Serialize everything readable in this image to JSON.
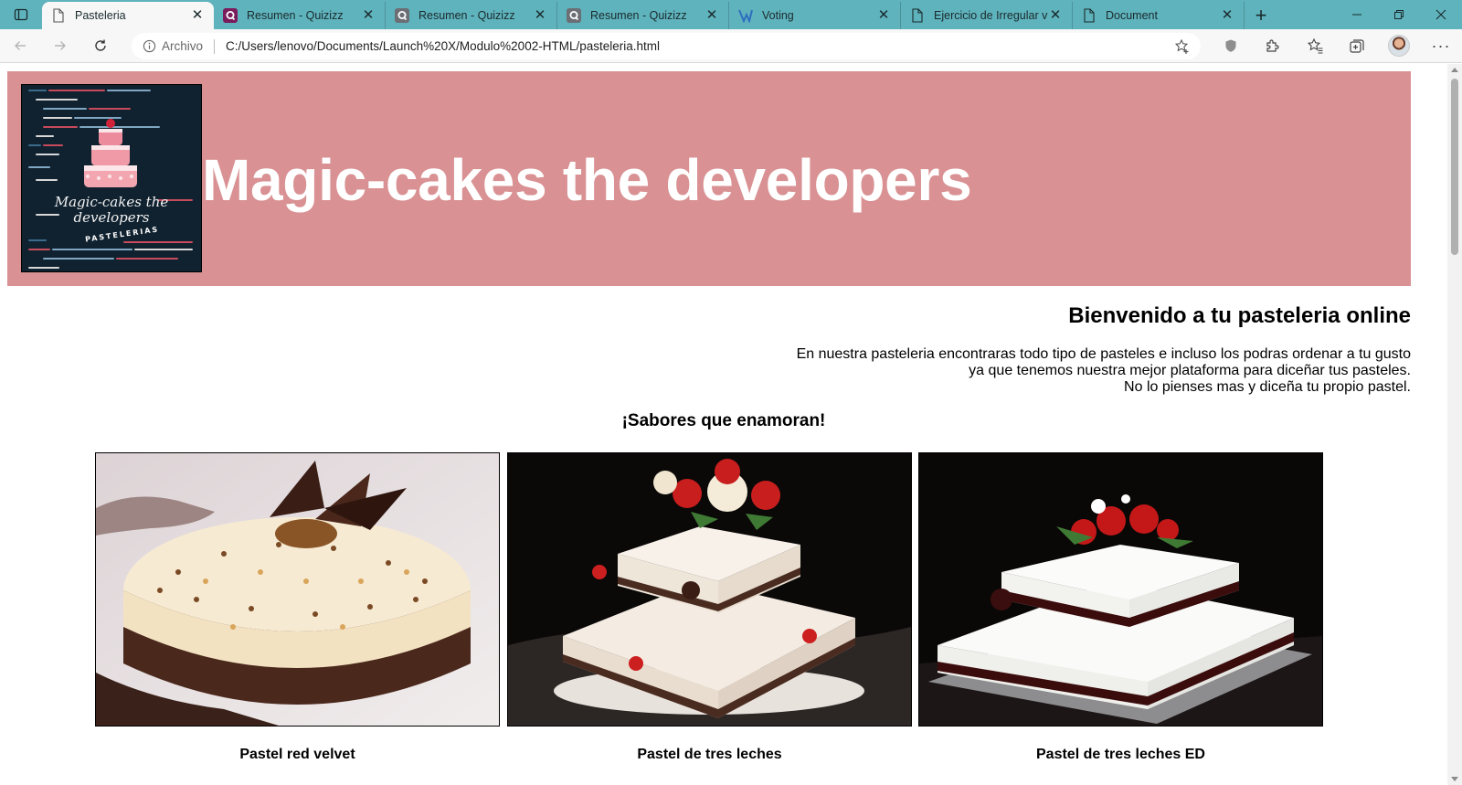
{
  "browser": {
    "tabs": [
      {
        "title": "Pasteleria",
        "icon": "page-icon",
        "active": true
      },
      {
        "title": "Resumen - Quizizz",
        "icon": "quizizz-icon",
        "active": false
      },
      {
        "title": "Resumen - Quizizz",
        "icon": "quizizz-icon",
        "active": false
      },
      {
        "title": "Resumen - Quizizz",
        "icon": "quizizz-icon",
        "active": false
      },
      {
        "title": "Voting",
        "icon": "voting-icon",
        "active": false
      },
      {
        "title": "Ejercicio de Irregular ve",
        "icon": "page-icon",
        "active": false
      },
      {
        "title": "Document",
        "icon": "page-icon",
        "active": false
      }
    ],
    "address": {
      "scheme_label": "Archivo",
      "url": "C:/Users/lenovo/Documents/Launch%20X/Modulo%2002-HTML/pasteleria.html"
    }
  },
  "page": {
    "header": {
      "logo_text_line1": "Magic-cakes the",
      "logo_text_line2": "developers",
      "logo_text_line3": "PASTELERIAS",
      "title": "Magic-cakes the developers"
    },
    "welcome_heading": "Bienvenido a tu pasteleria online",
    "intro_lines": [
      "En nuestra pasteleria encontraras todo tipo de pasteles e incluso los podras ordenar a tu gusto",
      "ya que tenemos nuestra mejor plataforma para diceñar tus pasteles.",
      "No lo pienses mas y diceña tu propio pastel."
    ],
    "tagline": "¡Sabores que enamoran!",
    "cakes": [
      {
        "name": "Pastel red velvet"
      },
      {
        "name": "Pastel de tres leches"
      },
      {
        "name": "Pastel de tres leches ED"
      }
    ]
  },
  "colors": {
    "tabstrip": "#5fb3bd",
    "banner": "#d99193",
    "title_text": "#ffffff"
  }
}
